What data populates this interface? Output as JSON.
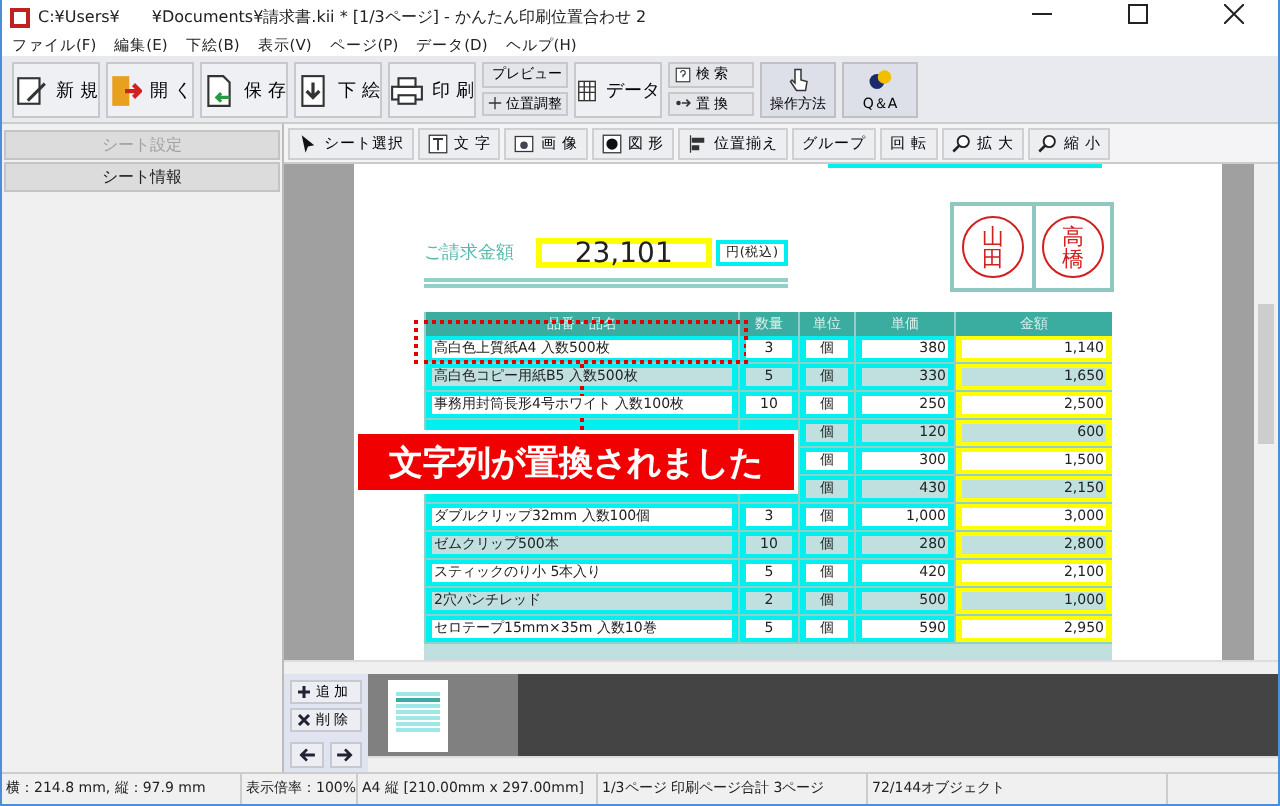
{
  "window": {
    "title": "C:¥Users¥　　¥Documents¥請求書.kii *  [1/3ページ] - かんたん印刷位置合わせ 2"
  },
  "menu": [
    "ファイル(F)",
    "編集(E)",
    "下絵(B)",
    "表示(V)",
    "ページ(P)",
    "データ(D)",
    "ヘルプ(H)"
  ],
  "toolbar": [
    {
      "kind": "big",
      "label": "新 規"
    },
    {
      "kind": "big",
      "label": "開 く"
    },
    {
      "kind": "big",
      "label": "保 存"
    },
    {
      "kind": "big",
      "label": "下 絵"
    },
    {
      "kind": "big",
      "label": "印 刷"
    },
    {
      "kind": "pair",
      "items": [
        "プレビュー",
        "位置調整"
      ]
    },
    {
      "kind": "big",
      "label": "データ"
    },
    {
      "kind": "pair",
      "items": [
        "検 索",
        "置 換"
      ]
    },
    {
      "kind": "tall",
      "label": "操作方法"
    },
    {
      "kind": "tall",
      "label": "Q＆A"
    }
  ],
  "sidebar": {
    "items": [
      {
        "label": "シート設定",
        "disabled": true
      },
      {
        "label": "シート情報",
        "disabled": false
      }
    ]
  },
  "sheet_toolbar": [
    "シート選択",
    "文 字",
    "画 像",
    "図 形",
    "位置揃え",
    "グループ",
    "回 転",
    "拡 大",
    "縮 小"
  ],
  "invoice": {
    "total_label": "ご請求金額",
    "total": "23,101",
    "tax_note": "円(税込)",
    "stamps": [
      "山田",
      "高橋"
    ],
    "columns": [
      "品番・品名",
      "数量",
      "単位",
      "単価",
      "金額"
    ],
    "rows": [
      {
        "name": "高白色上質紙A4 入数500枚",
        "qty": "3",
        "unit": "個",
        "price": "380",
        "amount": "1,140"
      },
      {
        "name": "高白色コピー用紙B5 入数500枚",
        "qty": "5",
        "unit": "個",
        "price": "330",
        "amount": "1,650"
      },
      {
        "name": "事務用封筒長形4号ホワイト 入数100枚",
        "qty": "10",
        "unit": "個",
        "price": "250",
        "amount": "2,500"
      },
      {
        "unit": "個",
        "price": "120",
        "amount": "600"
      },
      {
        "unit": "個",
        "price": "300",
        "amount": "1,500"
      },
      {
        "unit": "個",
        "price": "430",
        "amount": "2,150"
      },
      {
        "name": "ダブルクリップ32mm 入数100個",
        "qty": "3",
        "unit": "個",
        "price": "1,000",
        "amount": "3,000"
      },
      {
        "name": "ゼムクリップ500本",
        "qty": "10",
        "unit": "個",
        "price": "280",
        "amount": "2,800"
      },
      {
        "name": "スティックのり小 5本入り",
        "qty": "5",
        "unit": "個",
        "price": "420",
        "amount": "2,100"
      },
      {
        "name": "2穴パンチレッド",
        "qty": "2",
        "unit": "個",
        "price": "500",
        "amount": "1,000"
      },
      {
        "name": "セロテープ15mm×35m 入数10巻",
        "qty": "5",
        "unit": "個",
        "price": "590",
        "amount": "2,950"
      }
    ]
  },
  "notification": "文字列が置換されました",
  "thumbnails": {
    "buttons": [
      "追 加",
      "削 除"
    ]
  },
  "status_bar": [
    "横：214.8 mm, 縦：97.9 mm",
    "表示倍率：100%",
    "A4 縦 [210.00mm x 297.00mm]",
    "1/3ページ 印刷ページ合計 3ページ",
    "72/144オブジェクト"
  ]
}
